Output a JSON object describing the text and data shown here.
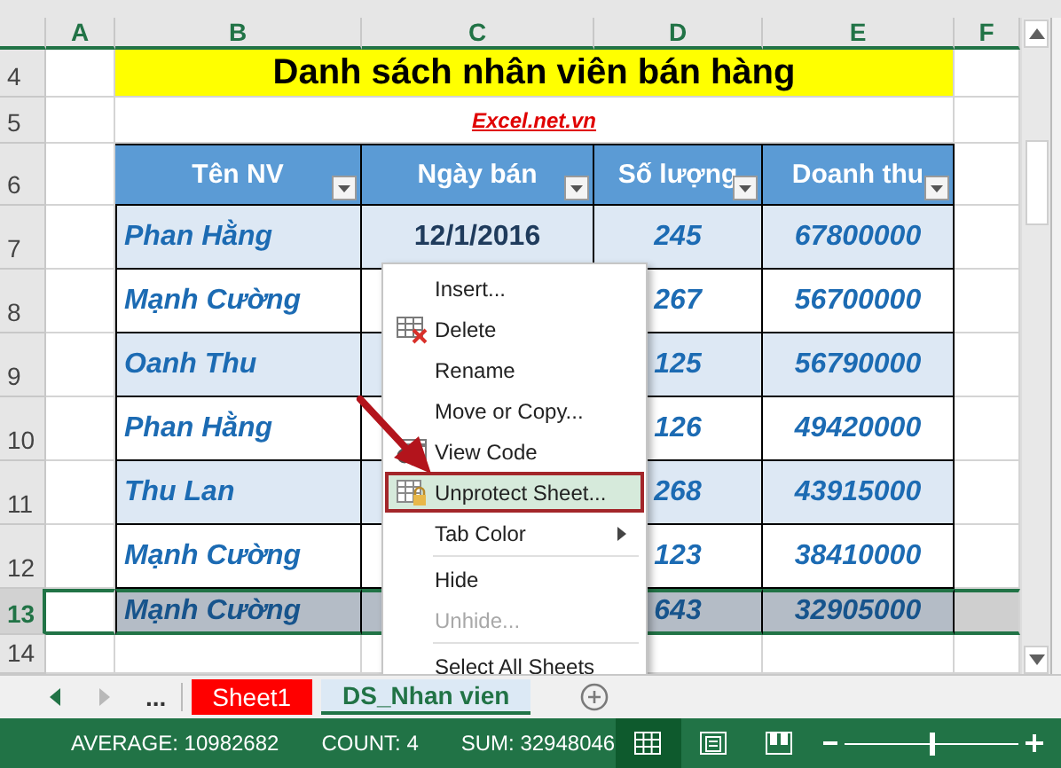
{
  "sheet": {
    "columns": [
      {
        "label": "A"
      },
      {
        "label": "B"
      },
      {
        "label": "C"
      },
      {
        "label": "D"
      },
      {
        "label": "E"
      },
      {
        "label": "F"
      }
    ],
    "row_numbers": [
      {
        "label": "4",
        "selected": false
      },
      {
        "label": "5",
        "selected": false
      },
      {
        "label": "6",
        "selected": false
      },
      {
        "label": "7",
        "selected": false
      },
      {
        "label": "8",
        "selected": false
      },
      {
        "label": "9",
        "selected": false
      },
      {
        "label": "10",
        "selected": false
      },
      {
        "label": "11",
        "selected": false
      },
      {
        "label": "12",
        "selected": false
      },
      {
        "label": "13",
        "selected": true
      },
      {
        "label": "14",
        "selected": false
      }
    ],
    "title": "Danh sách nhân viên bán hàng",
    "link": "Excel.net.vn",
    "table": {
      "headers": [
        "Tên NV",
        "Ngày bán",
        "Số lượng",
        "Doanh thu"
      ],
      "rows": [
        {
          "name": "Phan Hằng",
          "date": "12/1/2016",
          "quantity": "245",
          "revenue": "67800000",
          "selected": false
        },
        {
          "name": "Mạnh Cường",
          "quantity": "267",
          "revenue": "56700000",
          "selected": false
        },
        {
          "name": "Oanh Thu",
          "quantity": "125",
          "revenue": "56790000",
          "selected": false
        },
        {
          "name": "Phan Hằng",
          "quantity": "126",
          "revenue": "49420000",
          "selected": false
        },
        {
          "name": "Thu Lan",
          "quantity": "268",
          "revenue": "43915000",
          "selected": false
        },
        {
          "name": "Mạnh Cường",
          "quantity": "123",
          "revenue": "38410000",
          "selected": false
        },
        {
          "name": "Mạnh Cường",
          "quantity": "643",
          "revenue": "32905000",
          "selected": true
        }
      ]
    }
  },
  "context_menu": {
    "items": [
      {
        "kind": "plain",
        "label": "Insert...",
        "disabled": false,
        "selected": false
      },
      {
        "kind": "delete",
        "label": "Delete",
        "disabled": false,
        "selected": false
      },
      {
        "kind": "plain",
        "label": "Rename",
        "disabled": false,
        "selected": false
      },
      {
        "kind": "plain",
        "label": "Move or Copy...",
        "disabled": false,
        "selected": false
      },
      {
        "kind": "code",
        "label": "View Code",
        "disabled": false,
        "selected": false
      },
      {
        "kind": "protect",
        "label": "Unprotect Sheet...",
        "disabled": false,
        "selected": true
      },
      {
        "kind": "submenu",
        "label": "Tab Color",
        "disabled": false,
        "selected": false
      },
      {
        "kind": "separator"
      },
      {
        "kind": "plain",
        "label": "Hide",
        "disabled": false,
        "selected": false
      },
      {
        "kind": "plain",
        "label": "Unhide...",
        "disabled": true,
        "selected": false
      },
      {
        "kind": "separator"
      },
      {
        "kind": "plain",
        "label": "Select All Sheets",
        "disabled": false,
        "selected": false
      }
    ]
  },
  "sheet_tabs": {
    "more": "...",
    "tabs": [
      {
        "label": "Sheet1",
        "selected": false,
        "color": "#ff0000"
      },
      {
        "label": "DS_Nhan vien",
        "selected": true
      }
    ]
  },
  "status_bar": {
    "stats": [
      "AVERAGE: 10982682",
      "COUNT: 4",
      "SUM: 32948046"
    ],
    "views": [
      {
        "kind": "normal",
        "selected": true
      },
      {
        "kind": "layout",
        "selected": false
      },
      {
        "kind": "pagebreak",
        "selected": false
      }
    ],
    "zoom": {
      "level": 0.5
    }
  }
}
